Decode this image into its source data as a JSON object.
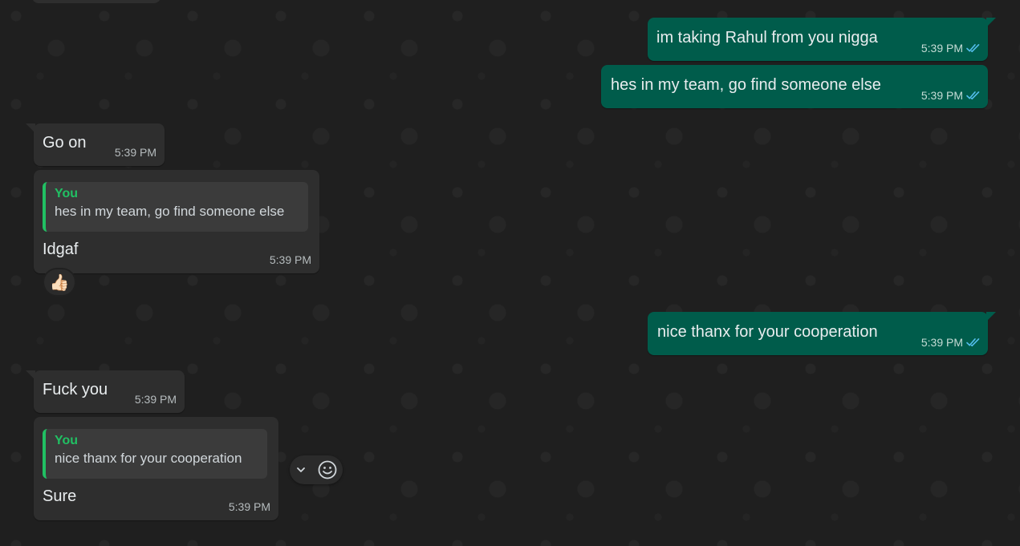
{
  "chat": {
    "messages": [
      {
        "id": "m1",
        "direction": "out",
        "text": "im taking Rahul from you nigga",
        "time": "5:39 PM",
        "status": "read"
      },
      {
        "id": "m2",
        "direction": "out",
        "text": "hes in my team, go find someone else",
        "time": "5:39 PM",
        "status": "read"
      },
      {
        "id": "m3",
        "direction": "in",
        "text": "Go on",
        "time": "5:39 PM"
      },
      {
        "id": "m4",
        "direction": "in",
        "quote": {
          "author": "You",
          "text": "hes in my team, go find someone else"
        },
        "text": "Idgaf",
        "time": "5:39 PM",
        "reaction": "👍🏻"
      },
      {
        "id": "m5",
        "direction": "out",
        "text": "nice thanx for your cooperation",
        "time": "5:39 PM",
        "status": "read"
      },
      {
        "id": "m6",
        "direction": "in",
        "text": "Fuck you",
        "time": "5:39 PM"
      },
      {
        "id": "m7",
        "direction": "in",
        "quote": {
          "author": "You",
          "text": "nice thanx for your cooperation"
        },
        "text": "Sure",
        "time": "5:39 PM"
      }
    ]
  },
  "icons": {
    "read_receipt": "double-check-icon",
    "message_menu": "chevron-down-icon",
    "react": "emoji-icon"
  },
  "colors": {
    "background": "#202020",
    "incoming_bubble": "#2e2e2e",
    "outgoing_bubble": "#005c4b",
    "quote_bar": "#21c063",
    "read_tick": "#53bdeb"
  }
}
